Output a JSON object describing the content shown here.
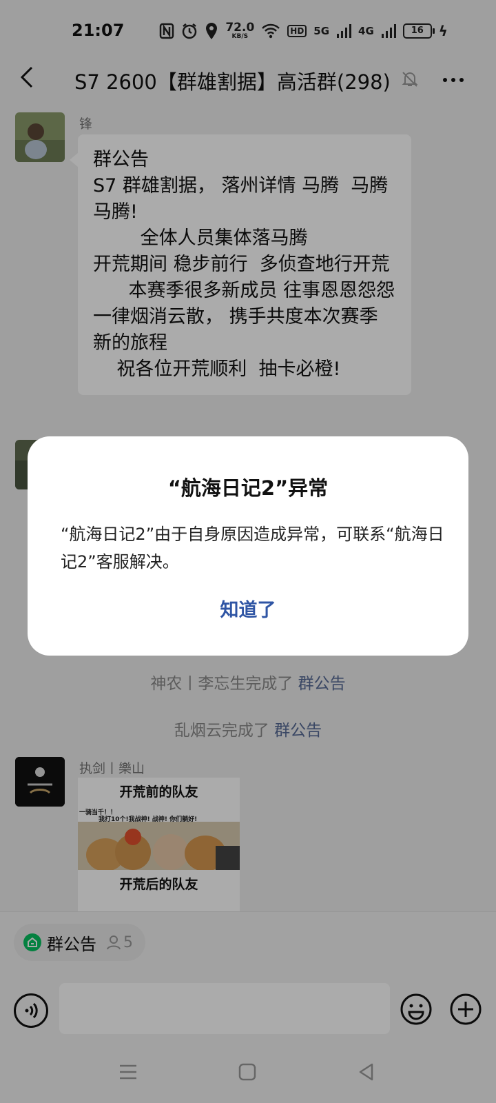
{
  "status_bar": {
    "time": "21:07",
    "speed_value": "72.0",
    "speed_unit": "KB/S",
    "hd": "HD",
    "net1": "5G",
    "net2": "4G",
    "battery": "16"
  },
  "header": {
    "title": "S7 2600【群雄割据】高活群(298)"
  },
  "messages": [
    {
      "sender": "锋",
      "text": "群公告\nS7 群雄割据， 落州详情 马腾  马腾 马腾!\n        全体人员集体落马腾\n开荒期间 稳步前行  多侦查地行开荒\n      本赛季很多新成员 往事恩恩怨怨一律烟消云散， 携手共度本次赛季新的旅程\n    祝各位开荒顺利  抽卡必橙!"
    },
    {
      "sender": "执剑丨樂山",
      "image_text_top": "开荒前的队友",
      "image_text_bottom": "开荒后的队友",
      "image_caption_1": "一骑当千！！",
      "image_caption_2": "我打10个!我战神! 战神! 你们躺好!"
    }
  ],
  "system_notices": [
    {
      "prefix": "神农丨李忘生完成了 ",
      "link": "群公告"
    },
    {
      "prefix": "乱烟云完成了 ",
      "link": "群公告"
    }
  ],
  "pinned": {
    "label": "群公告",
    "count": "5"
  },
  "input": {
    "placeholder": ""
  },
  "dialog": {
    "title": "“航海日记2”异常",
    "message": "“航海日记2”由于自身原因造成异常，可联系“航海日记2”客服解决。",
    "button": "知道了"
  },
  "colors": {
    "link": "#576b95",
    "dialog_button": "#2f55a4",
    "pinned_icon": "#07c160"
  }
}
